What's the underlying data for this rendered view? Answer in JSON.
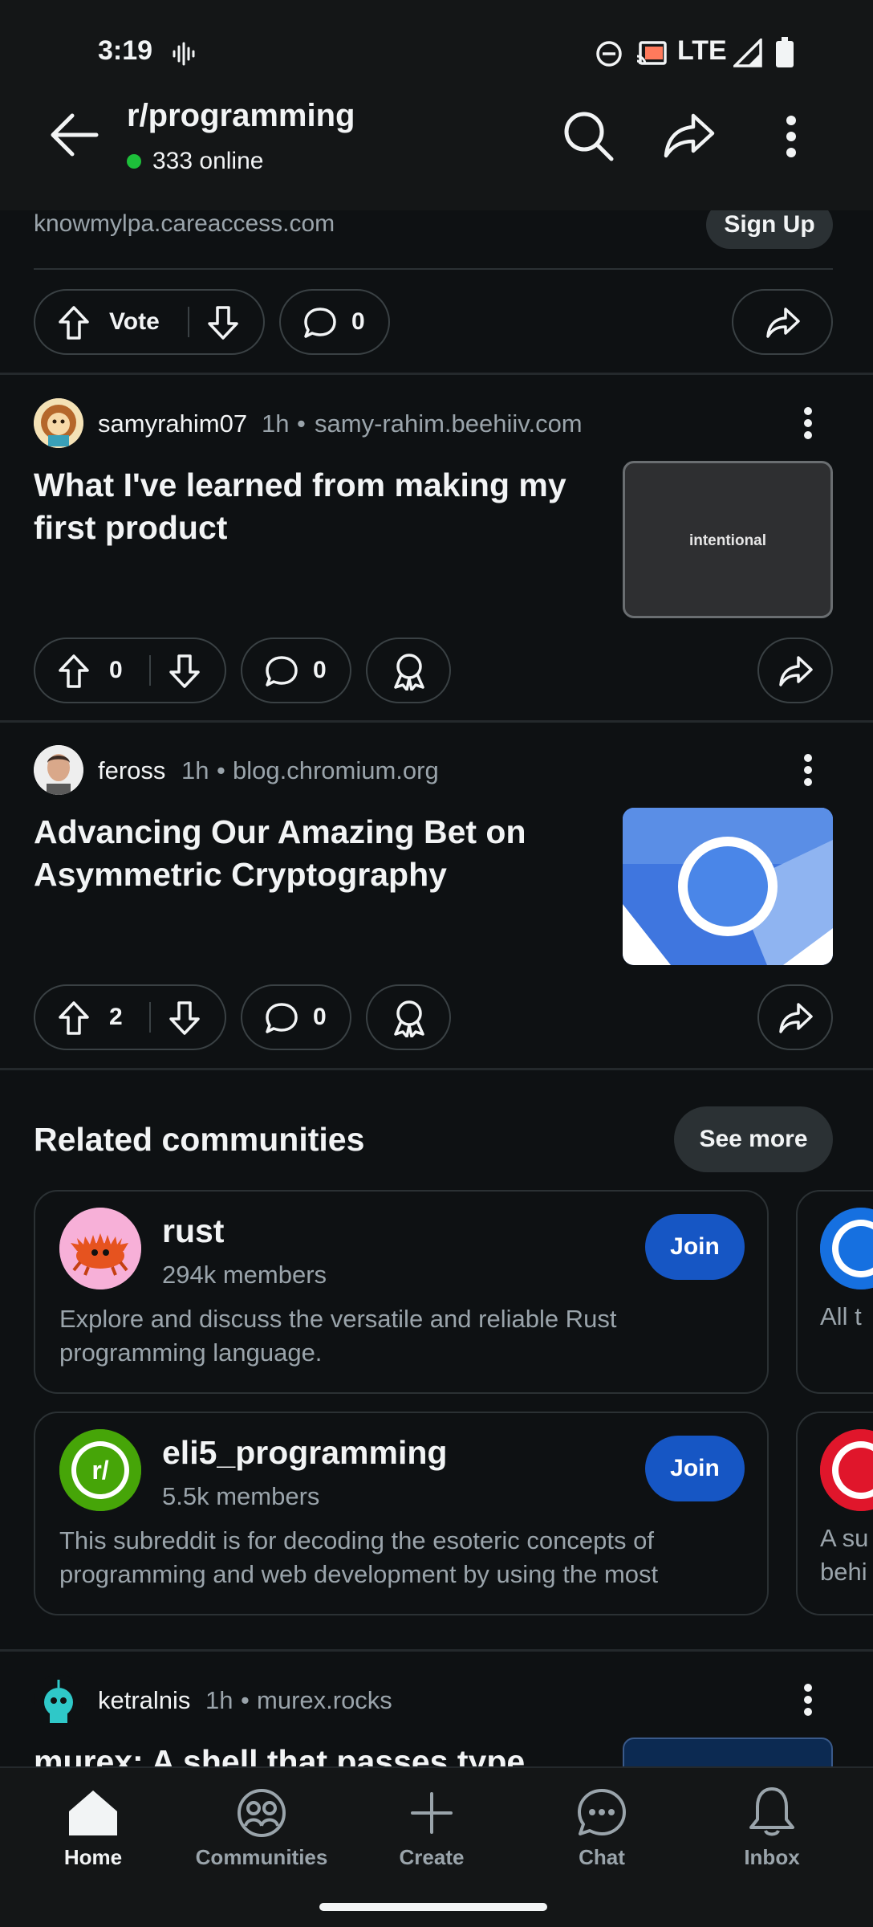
{
  "status_bar": {
    "time": "3:19",
    "network": "LTE"
  },
  "header": {
    "subreddit": "r/programming",
    "online": "333 online"
  },
  "ad_post": {
    "domain": "knowmylpa.careaccess.com",
    "cta": "Sign Up",
    "vote_label": "Vote",
    "comments": "0"
  },
  "posts": [
    {
      "author": "samyrahim07",
      "age": "1h",
      "domain": "samy-rahim.beehiiv.com",
      "title": "What I've learned from making my first product",
      "thumb_text": "intentional",
      "votes": "0",
      "comments": "0"
    },
    {
      "author": "feross",
      "age": "1h",
      "domain": "blog.chromium.org",
      "title": "Advancing Our Amazing Bet on Asymmetric Cryptography",
      "votes": "2",
      "comments": "0"
    },
    {
      "author": "ketralnis",
      "age": "1h",
      "domain": "murex.rocks",
      "title": "murex: A shell that passes type"
    }
  ],
  "related": {
    "heading": "Related communities",
    "see_more": "See more",
    "join_label": "Join",
    "communities": [
      {
        "name": "rust",
        "members": "294k members",
        "description": "Explore and discuss the versatile and reliable Rust programming language."
      },
      {
        "name": "eli5_programming",
        "members": "5.5k members",
        "description": "This subreddit is for decoding the esoteric concepts of programming and web development by using the most simpl..."
      }
    ],
    "peek_texts": [
      "All t",
      "A su",
      "behi"
    ]
  },
  "bottom_nav": {
    "home": "Home",
    "communities": "Communities",
    "create": "Create",
    "chat": "Chat",
    "inbox": "Inbox"
  },
  "colors": {
    "background": "#0e1113",
    "join_button": "#1656c4",
    "online_dot": "#1dbf3a",
    "eli5_icon": "#46a508",
    "rust_icon_bg": "#f7b0d8"
  }
}
